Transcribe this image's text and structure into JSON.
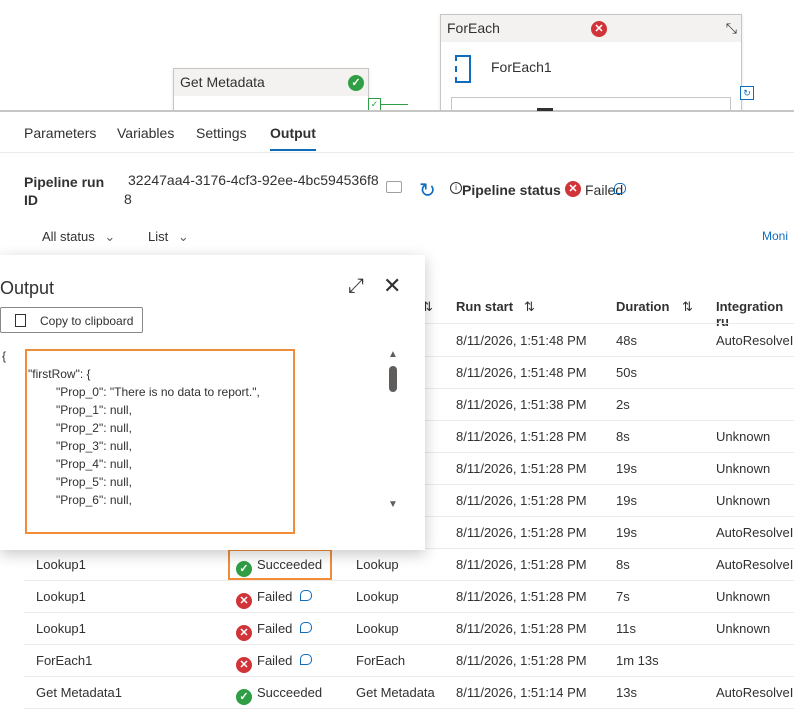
{
  "canvas": {
    "get_metadata": {
      "title": "Get Metadata"
    },
    "foreach": {
      "title": "ForEach",
      "inner_label": "ForEach1"
    }
  },
  "tabs": [
    {
      "label": "Parameters"
    },
    {
      "label": "Variables"
    },
    {
      "label": "Settings"
    },
    {
      "label": "Output",
      "active": true
    }
  ],
  "run": {
    "id_label_line1": "Pipeline run",
    "id_label_line2": "ID",
    "id_value_line1": "32247aa4-3176-4cf3-92ee-4bc594536f8",
    "id_value_line2": "8",
    "status_label": "Pipeline status",
    "status_value": "Failed"
  },
  "filters": {
    "status": "All status",
    "view": "List",
    "monitor_link": "Moni"
  },
  "table": {
    "headers": {
      "run_start": "Run start",
      "duration": "Duration",
      "integration": "Integration ru"
    },
    "rows": [
      {
        "name": "",
        "status": "",
        "type": "",
        "run_start": "8/11/2026, 1:51:48 PM",
        "duration": "48s",
        "integration": "AutoResolveIn"
      },
      {
        "name": "",
        "status": "",
        "type": "",
        "run_start": "8/11/2026, 1:51:48 PM",
        "duration": "50s",
        "integration": ""
      },
      {
        "name": "",
        "status": "",
        "type": "",
        "run_start": "8/11/2026, 1:51:38 PM",
        "duration": "2s",
        "integration": ""
      },
      {
        "name": "",
        "status": "",
        "type": "",
        "run_start": "8/11/2026, 1:51:28 PM",
        "duration": "8s",
        "integration": "Unknown"
      },
      {
        "name": "",
        "status": "",
        "type": "",
        "run_start": "8/11/2026, 1:51:28 PM",
        "duration": "19s",
        "integration": "Unknown"
      },
      {
        "name": "",
        "status": "",
        "type": "",
        "run_start": "8/11/2026, 1:51:28 PM",
        "duration": "19s",
        "integration": "Unknown"
      },
      {
        "name": "",
        "status": "",
        "type": "",
        "run_start": "8/11/2026, 1:51:28 PM",
        "duration": "19s",
        "integration": "AutoResolveIn"
      },
      {
        "name": "Lookup1",
        "status": "Succeeded",
        "type": "Lookup",
        "run_start": "8/11/2026, 1:51:28 PM",
        "duration": "8s",
        "integration": "AutoResolveIn"
      },
      {
        "name": "Lookup1",
        "status": "Failed",
        "type": "Lookup",
        "run_start": "8/11/2026, 1:51:28 PM",
        "duration": "7s",
        "integration": "Unknown"
      },
      {
        "name": "Lookup1",
        "status": "Failed",
        "type": "Lookup",
        "run_start": "8/11/2026, 1:51:28 PM",
        "duration": "11s",
        "integration": "Unknown"
      },
      {
        "name": "ForEach1",
        "status": "Failed",
        "type": "ForEach",
        "run_start": "8/11/2026, 1:51:28 PM",
        "duration": "1m 13s",
        "integration": ""
      },
      {
        "name": "Get Metadata1",
        "status": "Succeeded",
        "type": "Get Metadata",
        "run_start": "8/11/2026, 1:51:14 PM",
        "duration": "13s",
        "integration": "AutoResolveIn"
      }
    ]
  },
  "output_panel": {
    "title": "Output",
    "copy_label": "Copy to clipboard",
    "json_lines": [
      "{",
      "\"firstRow\": {",
      "\"Prop_0\": \"There is no data to report.\",",
      "\"Prop_1\": null,",
      "\"Prop_2\": null,",
      "\"Prop_3\": null,",
      "\"Prop_4\": null,",
      "\"Prop_5\": null,",
      "\"Prop_6\": null,"
    ]
  },
  "colors": {
    "accent": "#0f6cbd",
    "success": "#2f9e44",
    "error": "#d13438",
    "highlight": "#f08c3a"
  }
}
